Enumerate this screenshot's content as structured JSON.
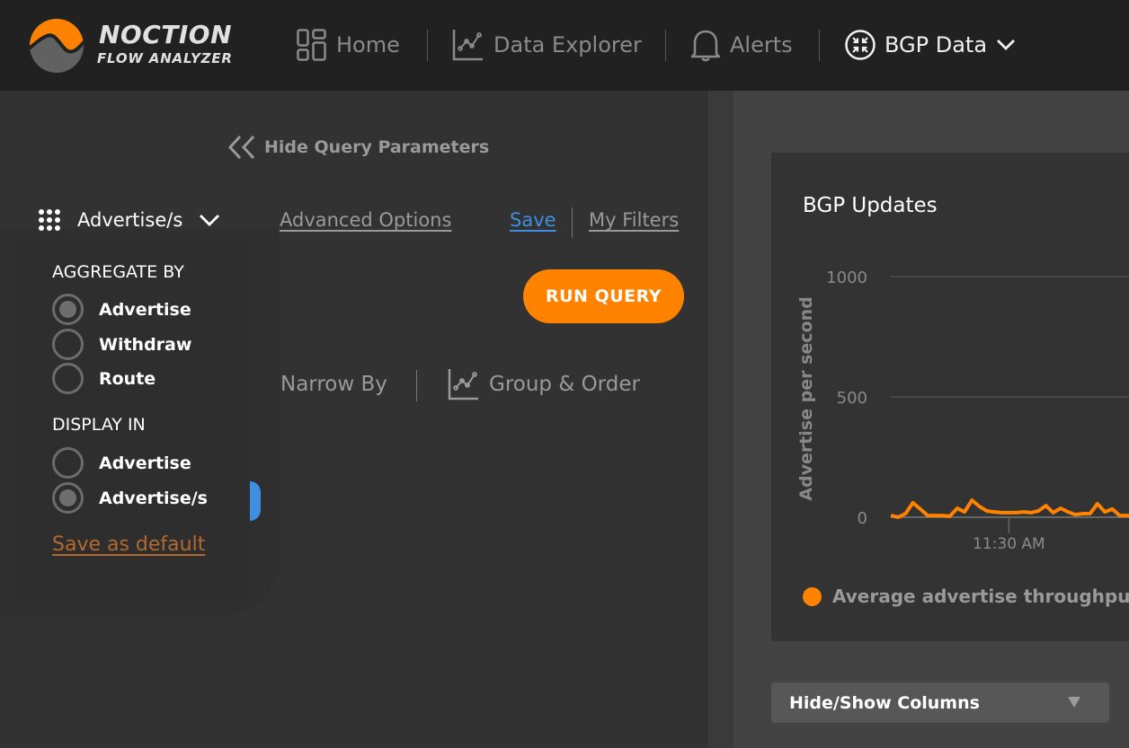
{
  "brand": {
    "name": "NOCTION",
    "product": "FLOW ANALYZER",
    "accent": "#ff8200"
  },
  "nav": [
    {
      "label": "Home",
      "icon": "dashboard-grid-icon"
    },
    {
      "label": "Data Explorer",
      "icon": "line-chart-icon"
    },
    {
      "label": "Alerts",
      "icon": "bell-icon"
    },
    {
      "label": "BGP Data",
      "icon": "bgp-arrows-icon",
      "active": true
    }
  ],
  "query": {
    "hide_label": "Hide Query Parameters",
    "metric_selected": "Advertise/s",
    "advanced_options": "Advanced Options",
    "save": "Save",
    "my_filters": "My Filters",
    "run_query": "RUN QUERY",
    "narrow_by": "Narrow By",
    "group_order": "Group & Order"
  },
  "dropdown": {
    "aggregate_heading": "AGGREGATE BY",
    "aggregate_options": [
      {
        "label": "Advertise",
        "selected": true
      },
      {
        "label": "Withdraw",
        "selected": false
      },
      {
        "label": "Route",
        "selected": false
      }
    ],
    "display_heading": "DISPLAY IN",
    "display_options": [
      {
        "label": "Advertise",
        "selected": false
      },
      {
        "label": "Advertise/s",
        "selected": true
      }
    ],
    "save_default": "Save as default"
  },
  "card": {
    "title": "BGP Updates",
    "hide_show_columns": "Hide/Show Columns"
  },
  "chart_data": {
    "type": "line",
    "title": "BGP Updates",
    "xlabel": "",
    "ylabel": "Advertise per second",
    "ylim": [
      0,
      1000
    ],
    "yticks": [
      0,
      500,
      1000
    ],
    "xtick_labels": [
      {
        "index": 16,
        "label": "11:30 AM"
      }
    ],
    "grid": true,
    "legend": "bottom-left",
    "series": [
      {
        "name": "Average advertise throughput -",
        "color": "#ff8200",
        "values": [
          7,
          0,
          15,
          60,
          34,
          7,
          7,
          7,
          4,
          37,
          22,
          71,
          45,
          26,
          22,
          19,
          19,
          19,
          22,
          19,
          26,
          48,
          19,
          37,
          22,
          11,
          15,
          15,
          56,
          22,
          34,
          7,
          7,
          7
        ]
      }
    ]
  }
}
